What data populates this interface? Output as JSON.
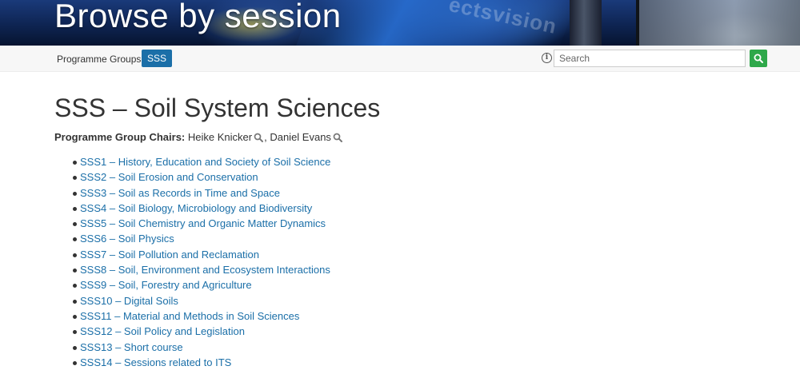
{
  "header": {
    "title": "Browse by session",
    "watermark": "ectsvision"
  },
  "toolbar": {
    "programme_groups_label": "Programme Groups:",
    "programme_group_badge": "SSS",
    "info_icon": "info-circle-icon",
    "search_placeholder": "Search",
    "search_value": "",
    "search_icon": "magnifier-icon"
  },
  "colors": {
    "accent_blue": "#1b6fa8",
    "search_green": "#2ea84a",
    "text": "#333333"
  },
  "main": {
    "section_title": "SSS – Soil System Sciences",
    "chairs_label": "Programme Group Chairs:",
    "chairs": [
      {
        "name": "Heike Knicker"
      },
      {
        "name": "Daniel Evans"
      }
    ],
    "sessions": [
      {
        "label": "SSS1 – History, Education and Society of Soil Science"
      },
      {
        "label": "SSS2 – Soil Erosion and Conservation"
      },
      {
        "label": "SSS3 – Soil as Records in Time and Space"
      },
      {
        "label": "SSS4 – Soil Biology, Microbiology and Biodiversity"
      },
      {
        "label": "SSS5 – Soil Chemistry and Organic Matter Dynamics"
      },
      {
        "label": "SSS6 – Soil Physics"
      },
      {
        "label": "SSS7 – Soil Pollution and Reclamation"
      },
      {
        "label": "SSS8 – Soil, Environment and Ecosystem Interactions"
      },
      {
        "label": "SSS9 – Soil, Forestry and Agriculture"
      },
      {
        "label": "SSS10 – Digital Soils"
      },
      {
        "label": "SSS11 – Material and Methods in Soil Sciences"
      },
      {
        "label": "SSS12 – Soil Policy and Legislation"
      },
      {
        "label": "SSS13 – Short course"
      },
      {
        "label": "SSS14 – Sessions related to ITS"
      }
    ]
  }
}
